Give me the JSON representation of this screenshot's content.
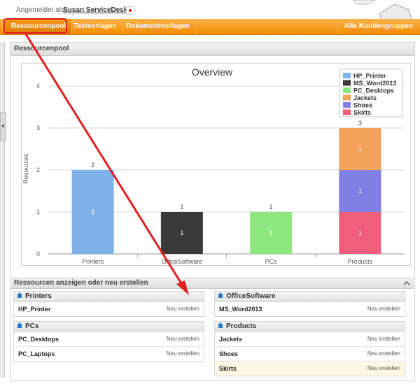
{
  "header": {
    "logged_label": "Angemeldet als:",
    "user": "Susan ServiceDesk"
  },
  "nav": {
    "items": [
      "Ressourcenpool",
      "Textvorlagen",
      "Dokumentvorlagen"
    ],
    "right": "Alle Kundengruppen"
  },
  "panel": {
    "title": "Ressourcenpool"
  },
  "chart_data": {
    "type": "bar",
    "title": "Overview",
    "xlabel": "",
    "ylabel": "Resources",
    "ylim": [
      0,
      4
    ],
    "yticks": [
      0,
      1,
      2,
      3,
      4
    ],
    "categories": [
      "Printers",
      "OfficeSoftware",
      "PCs",
      "Products"
    ],
    "totals": [
      2,
      1,
      1,
      3
    ],
    "segments": [
      {
        "category": "Printers",
        "series": "HP_Printer",
        "value": 2
      },
      {
        "category": "OfficeSoftware",
        "series": "MS_Word2013",
        "value": 1
      },
      {
        "category": "PCs",
        "series": "PC_Desktops",
        "value": 1
      },
      {
        "category": "Products",
        "series": "Skirts",
        "value": 1
      },
      {
        "category": "Products",
        "series": "Shoes",
        "value": 1
      },
      {
        "category": "Products",
        "series": "Jackets",
        "value": 1
      }
    ],
    "legend": [
      {
        "name": "HP_Printer",
        "color": "#7fb2e8"
      },
      {
        "name": "MS_Word2013",
        "color": "#3a3a3a"
      },
      {
        "name": "PC_Desktops",
        "color": "#8ee77e"
      },
      {
        "name": "Jackets",
        "color": "#f2a25b"
      },
      {
        "name": "Shoes",
        "color": "#7f7fe6"
      },
      {
        "name": "Skirts",
        "color": "#ef5e7d"
      }
    ],
    "legend_position": "top-right",
    "grid": true
  },
  "section": {
    "title": "Ressourcen anzeigen oder neu erstellen"
  },
  "groups": [
    {
      "title": "Printers",
      "items": [
        {
          "name": "HP_Printer",
          "action": "Neu erstellen"
        }
      ]
    },
    {
      "title": "OfficeSoftware",
      "items": [
        {
          "name": "MS_Word2013",
          "action": "Neu erstellen"
        }
      ]
    },
    {
      "title": "PCs",
      "items": [
        {
          "name": "PC_Desktops",
          "action": "Neu erstellen"
        },
        {
          "name": "PC_Laptops",
          "action": "Neu erstellen"
        }
      ]
    },
    {
      "title": "Products",
      "items": [
        {
          "name": "Jackets",
          "action": "Neu erstellen"
        },
        {
          "name": "Shoes",
          "action": "Neu erstellen"
        },
        {
          "name": "Skirts",
          "action": "Neu erstellen"
        }
      ]
    }
  ],
  "colors": {
    "nav_orange": "#f39a1e",
    "annotation_red": "#e02020",
    "highlight_row": "#fff8e4"
  }
}
